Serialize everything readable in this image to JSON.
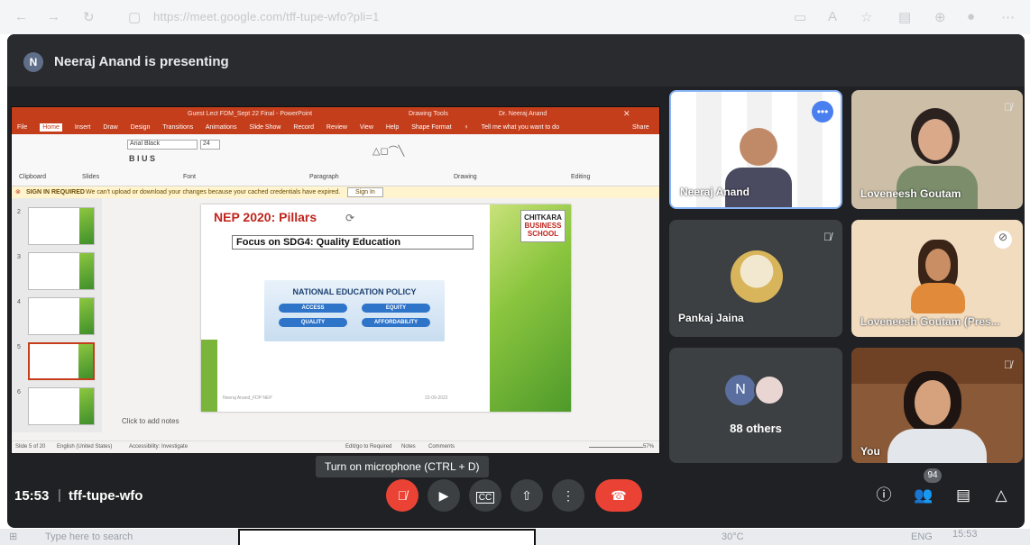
{
  "browser": {
    "url": "https://meet.google.com/tff-tupe-wfo?pli=1"
  },
  "meeting": {
    "presenter_initial": "N",
    "presenting_text": "Neeraj Anand is presenting",
    "time": "15:53",
    "separator": "|",
    "code": "tff-tupe-wfo",
    "tooltip": "Turn on microphone (CTRL + D)",
    "people_badge": "94"
  },
  "ppt": {
    "window_title": "Guest Lect FDM_Sept 22 Final - PowerPoint",
    "drawing_tools": "Drawing Tools",
    "user": "Dr. Neeraj Anand",
    "tabs": [
      "File",
      "Home",
      "Insert",
      "Draw",
      "Design",
      "Transitions",
      "Animations",
      "Slide Show",
      "Record",
      "Review",
      "View",
      "Help",
      "Shape Format"
    ],
    "tell_me": "Tell me what you want to do",
    "share": "Share",
    "font_name": "Arial Black",
    "font_size": "24",
    "groups": [
      "Clipboard",
      "Slides",
      "Font",
      "Paragraph",
      "Drawing",
      "Editing"
    ],
    "warning_label": "SIGN IN REQUIRED",
    "warning_text": "We can't upload or download your changes because your cached credentials have expired.",
    "sign_in": "Sign In",
    "thumb_numbers": [
      "2",
      "3",
      "4",
      "5",
      "6"
    ],
    "slide_title": "NEP 2020: Pillars",
    "slide_subtitle": "Focus on SDG4: Quality Education",
    "logo_line1": "CHITKARA",
    "logo_line2": "BUSINESS",
    "logo_line3": "SCHOOL",
    "nep_heading": "NATIONAL EDUCATION POLICY",
    "pillars": [
      "ACCESS",
      "EQUITY",
      "QUALITY",
      "AFFORDABILITY"
    ],
    "foot_left": "Neeraj Anand_FDP NEP",
    "foot_right": "22-09-2022",
    "notes_placeholder": "Click to add notes",
    "status_slide": "Slide 5 of 20",
    "status_lang": "English (United States)",
    "status_access": "Accessibility: Investigate",
    "status_edit": "Edit/go to Required",
    "status_notes": "Notes",
    "status_comments": "Comments",
    "zoom": "57%"
  },
  "participants": [
    {
      "name": "Neeraj Anand"
    },
    {
      "name": "Loveneesh Goutam"
    },
    {
      "name": "Pankaj Jaina"
    },
    {
      "name": "Loveneesh Goutam (Pres..."
    },
    {
      "name": "88 others",
      "initial": "N"
    },
    {
      "name": "You"
    }
  ],
  "taskbar": {
    "search": "Type here to search",
    "time": "15:53",
    "lang": "ENG",
    "temp": "30°C"
  },
  "colors": {
    "meet_bg": "#202124",
    "end_call": "#ea4335",
    "ppt_accent": "#c43e1c"
  }
}
